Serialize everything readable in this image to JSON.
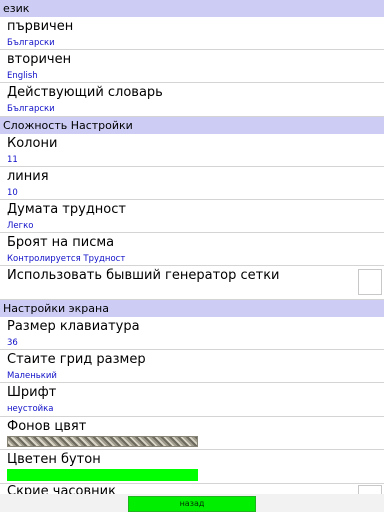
{
  "sections": {
    "language": "език",
    "difficulty": "Сложность Настройки",
    "screen": "Настройки экрана"
  },
  "items": {
    "primary": {
      "title": "първичен",
      "value": "Български"
    },
    "secondary": {
      "title": "вторичен",
      "value": "English"
    },
    "dictionary": {
      "title": "Действующий словарь",
      "value": "Български"
    },
    "columns": {
      "title": "Колони",
      "value": "11"
    },
    "lines": {
      "title": "линия",
      "value": "10"
    },
    "word_difficulty": {
      "title": "Думата трудност",
      "value": "Легко"
    },
    "letter_count": {
      "title": "Броят на писма",
      "value": "Контролируется Трудност"
    },
    "old_generator": {
      "title": "Использовать бывший генератор сетки",
      "checked": false
    },
    "keyboard_size": {
      "title": "Размер клавиатура",
      "value": "36"
    },
    "grid_size": {
      "title": "Стаите грид размер",
      "value": "Маленький"
    },
    "font": {
      "title": "Шрифт",
      "value": "неустойка"
    },
    "background_color": {
      "title": "Фонов цвят",
      "swatch": "woven-pattern"
    },
    "button_color": {
      "title": "Цветен бутон",
      "swatch": "#00ff00"
    },
    "hide_clock": {
      "title": "Скрие часовник",
      "checked": false
    }
  },
  "footer": {
    "back_label": "назад"
  },
  "colors": {
    "section_bg": "#ccccf5",
    "value_text": "#1010c8",
    "accent_green": "#00ff00"
  }
}
